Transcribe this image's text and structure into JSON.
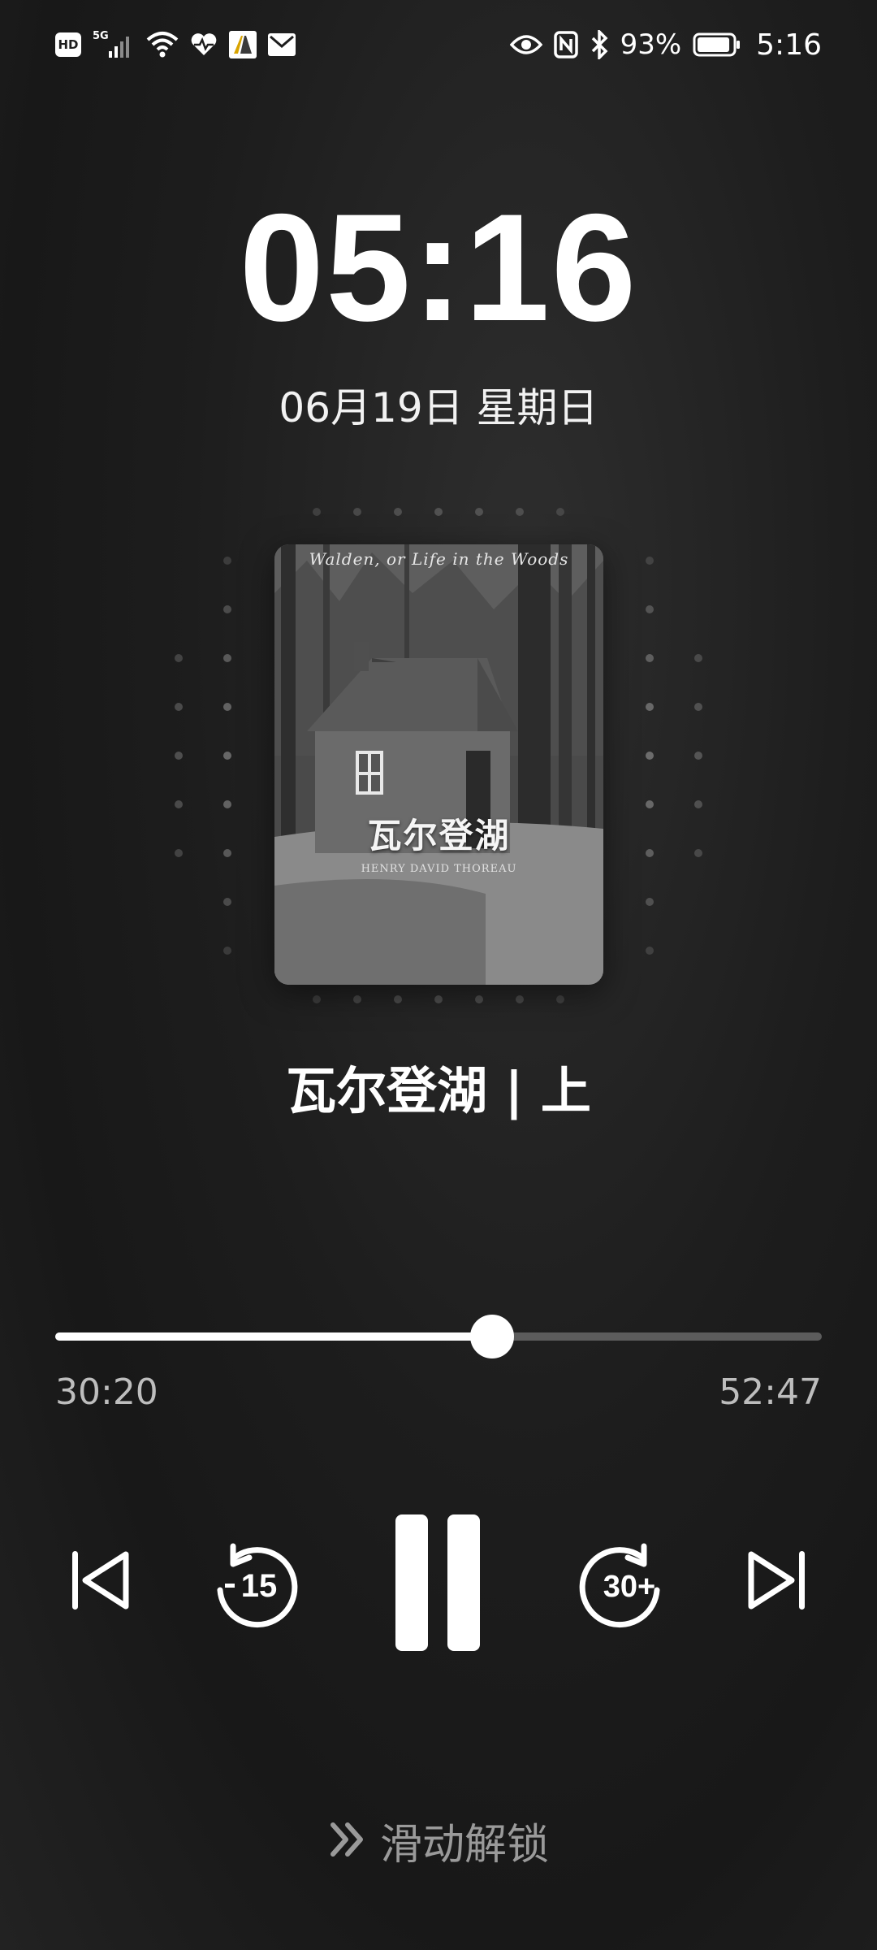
{
  "status_bar": {
    "network_badge": "HD",
    "signal_label": "5G",
    "battery_percent": "93%",
    "time": "5:16",
    "icons": [
      "hd-icon",
      "5g-signal-icon",
      "wifi-icon",
      "health-icon",
      "app-notification-icon",
      "mail-icon",
      "eye-icon",
      "nfc-icon",
      "bluetooth-icon",
      "battery-icon"
    ],
    "battery_level": 0.93
  },
  "lockscreen": {
    "clock": "05:16",
    "date": "06月19日 星期日"
  },
  "media": {
    "cover": {
      "english_title": "Walden, or Life in the Woods",
      "chinese_title": "瓦尔登湖",
      "author": "HENRY DAVID THOREAU"
    },
    "track_title": "瓦尔登湖 | 上",
    "elapsed": "30:20",
    "duration": "52:47",
    "progress": 0.57,
    "controls": {
      "previous_icon": "skip-previous-icon",
      "rewind_icon": "rewind-15-icon",
      "rewind_label": "15",
      "pause_icon": "pause-icon",
      "forward_icon": "forward-30-icon",
      "forward_label": "30+",
      "next_icon": "skip-next-icon"
    }
  },
  "unlock": {
    "label": "滑动解锁",
    "icon": "double-chevron-right-icon"
  },
  "colors": {
    "background": "#1d1d1d",
    "foreground": "#ffffff",
    "muted": "#bdbdbd",
    "track": "#5c5c5c"
  }
}
